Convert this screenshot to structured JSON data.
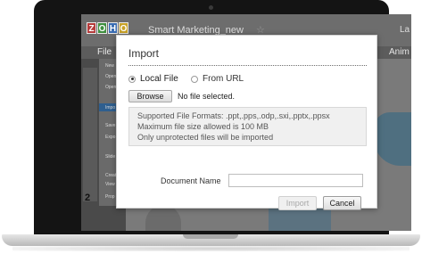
{
  "app": {
    "title": "Smart Marketing_new",
    "logo_letters": [
      "Z",
      "O",
      "H",
      "O"
    ],
    "logo_colors": [
      "#b53a3a",
      "#3f8f3f",
      "#3b6db3",
      "#c9a227"
    ],
    "user_short": "La",
    "menu_file": "File",
    "tab_animation": "Anim",
    "slide_number": "2",
    "file_menu_items": [
      "New",
      "Open",
      "Open",
      "Impo",
      "Save",
      "Expo",
      "Slide",
      "Creat",
      "View",
      "Prop"
    ]
  },
  "dialog": {
    "title": "Import",
    "source_local": "Local File",
    "source_url": "From URL",
    "selected_source": "local",
    "browse_label": "Browse",
    "file_status": "No file selected.",
    "info_lines": [
      "Supported File Formats: .ppt,.pps,.odp,.sxi,.pptx,.ppsx",
      "Maximum file size allowed is 100 MB",
      "Only unprotected files will be imported"
    ],
    "document_name_label": "Document Name",
    "document_name_value": "",
    "import_label": "Import",
    "cancel_label": "Cancel"
  },
  "icons": {
    "star": "star-icon",
    "camera": "camera-dot"
  }
}
